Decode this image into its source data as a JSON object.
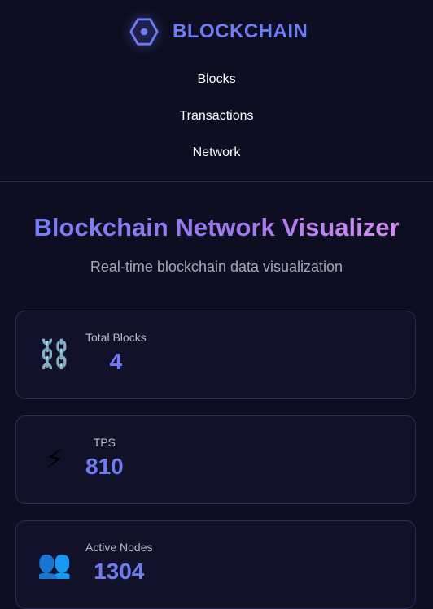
{
  "brand": {
    "name": "BLOCKCHAIN",
    "icon": "hexagon-logo-icon",
    "accent_color": "#6e7bf2"
  },
  "nav": {
    "items": [
      {
        "label": "Blocks"
      },
      {
        "label": "Transactions"
      },
      {
        "label": "Network"
      }
    ]
  },
  "hero": {
    "title": "Blockchain Network Visualizer",
    "subtitle": "Real-time blockchain data visualization"
  },
  "stats": [
    {
      "icon": "chain-icon",
      "glyph": "⛓️",
      "label": "Total Blocks",
      "value": "4"
    },
    {
      "icon": "lightning-icon",
      "glyph": "⚡",
      "label": "TPS",
      "value": "810"
    },
    {
      "icon": "users-icon",
      "glyph": "👥",
      "label": "Active Nodes",
      "value": "1304"
    }
  ]
}
